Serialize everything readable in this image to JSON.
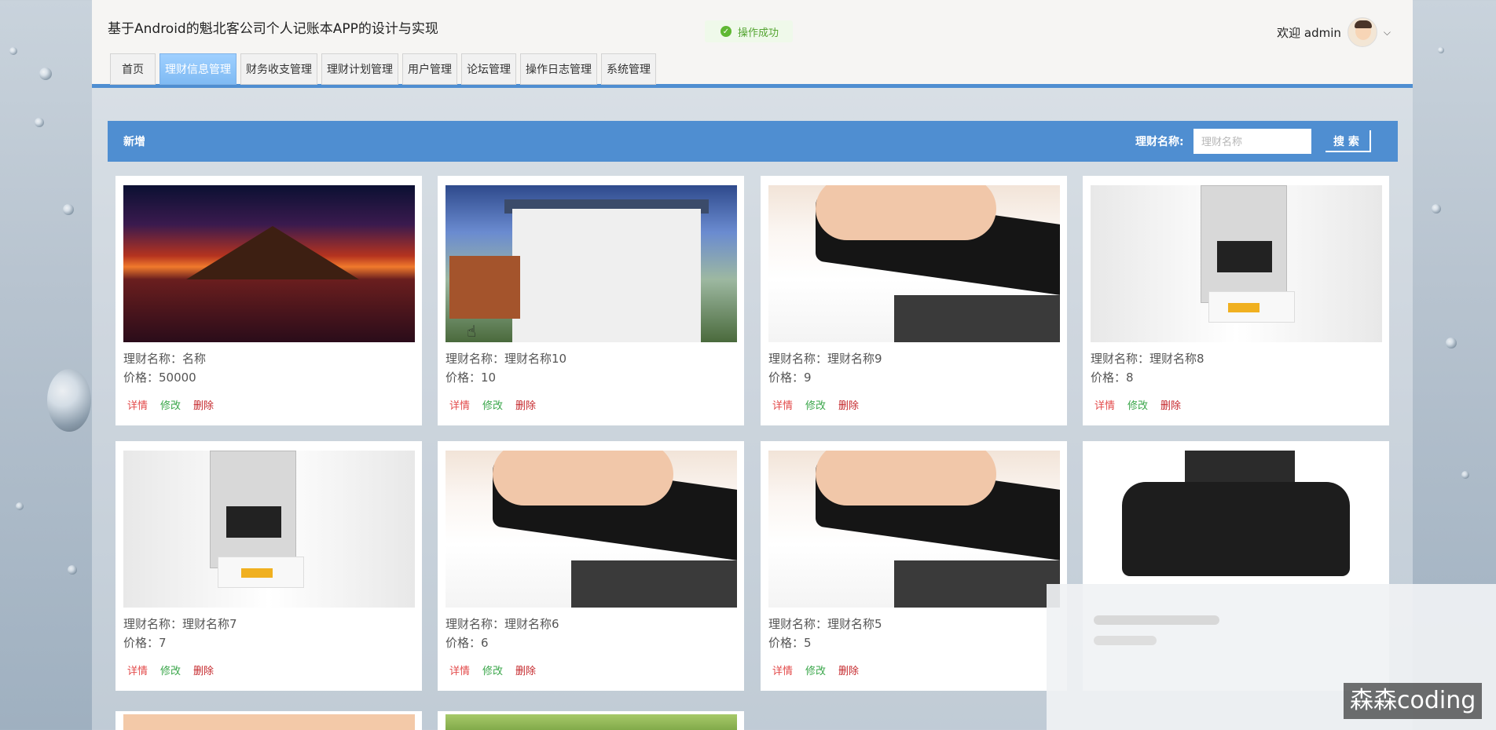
{
  "header": {
    "app_title": "基于Android的魁北客公司个人记账本APP的设计与实现",
    "toast": "操作成功",
    "welcome": "欢迎 admin"
  },
  "nav": [
    {
      "label": "首页",
      "active": false
    },
    {
      "label": "理财信息管理",
      "active": true
    },
    {
      "label": "财务收支管理",
      "active": false
    },
    {
      "label": "理财计划管理",
      "active": false
    },
    {
      "label": "用户管理",
      "active": false
    },
    {
      "label": "论坛管理",
      "active": false
    },
    {
      "label": "操作日志管理",
      "active": false
    },
    {
      "label": "系统管理",
      "active": false
    }
  ],
  "toolbar": {
    "add_label": "新增",
    "search_label": "理财名称:",
    "search_placeholder": "理财名称",
    "search_button": "搜 索"
  },
  "cards": [
    {
      "name_line": "理财名称：名称",
      "price_line": "价格：50000",
      "image": "sunset-mountain"
    },
    {
      "name_line": "理财名称：理财名称10",
      "price_line": "价格：10",
      "image": "house"
    },
    {
      "name_line": "理财名称：理财名称9",
      "price_line": "价格：9",
      "image": "stapler"
    },
    {
      "name_line": "理财名称：理财名称8",
      "price_line": "价格：8",
      "image": "binding-machine"
    },
    {
      "name_line": "理财名称：理财名称7",
      "price_line": "价格：7",
      "image": "binding-machine"
    },
    {
      "name_line": "理财名称：理财名称6",
      "price_line": "价格：6",
      "image": "stapler"
    },
    {
      "name_line": "理财名称：理财名称5",
      "price_line": "价格：5",
      "image": "stapler"
    },
    {
      "name_line": "",
      "price_line": "",
      "image": "printer"
    }
  ],
  "actions": {
    "detail": "详情",
    "edit": "修改",
    "delete": "删除"
  },
  "watermark": "森森coding",
  "colors": {
    "accent": "#4f8ed1",
    "detail": "#e34a4a",
    "edit": "#3aa64a",
    "delete": "#c5282c",
    "toast": "#55a532"
  }
}
